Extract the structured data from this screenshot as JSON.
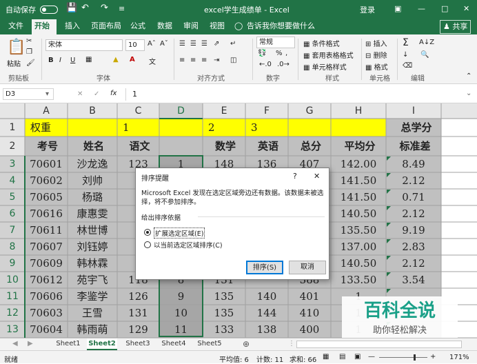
{
  "titlebar": {
    "autosave": "自动保存",
    "title": "excel学生成绩单 - Excel",
    "login": "登录"
  },
  "tabs": [
    "文件",
    "开始",
    "插入",
    "页面布局",
    "公式",
    "数据",
    "审阅",
    "视图"
  ],
  "tell_me": "告诉我你想要做什么",
  "share": "共享",
  "ribbon": {
    "paste": "粘贴",
    "clipboard": "剪贴板",
    "font_name": "宋体",
    "font_size": "10",
    "font_group": "字体",
    "align_group": "对齐方式",
    "num_format": "常规",
    "number_group": "数字",
    "cond_format": "条件格式",
    "table_format": "套用表格格式",
    "cell_style": "单元格样式",
    "styles_group": "样式",
    "insert": "插入",
    "delete": "删除",
    "format": "格式",
    "cells_group": "单元格",
    "editing_group": "编辑"
  },
  "namebox": "D3",
  "fx": "fx",
  "formula": "1",
  "columns": [
    "A",
    "B",
    "C",
    "D",
    "E",
    "F",
    "G",
    "H",
    "I"
  ],
  "rows": [
    "1",
    "2",
    "3",
    "4",
    "5",
    "6",
    "7",
    "8",
    "9",
    "10",
    "11",
    "12",
    "13"
  ],
  "row1": {
    "a": "权重",
    "c": "1",
    "e": "2",
    "f": "3",
    "i": "总学分"
  },
  "row2": {
    "a": "考号",
    "b": "姓名",
    "c": "语文",
    "e": "数学",
    "f": "英语",
    "g": "总分",
    "h": "平均分",
    "i": "标准差"
  },
  "data": [
    [
      "70601",
      "沙龙逸",
      "123",
      "1",
      "148",
      "136",
      "407",
      "142.00",
      "8.49"
    ],
    [
      "70602",
      "刘帅",
      "1",
      "",
      "",
      "",
      "",
      "141.50",
      "2.12"
    ],
    [
      "70605",
      "杨璐",
      "1",
      "",
      "",
      "",
      "",
      "141.50",
      "0.71"
    ],
    [
      "70616",
      "康惠雯",
      "1",
      "",
      "",
      "",
      "",
      "140.50",
      "2.12"
    ],
    [
      "70611",
      "林世博",
      "1",
      "",
      "",
      "",
      "",
      "135.50",
      "9.19"
    ],
    [
      "70607",
      "刘钰婷",
      "1",
      "",
      "",
      "",
      "",
      "137.00",
      "2.83"
    ],
    [
      "70609",
      "韩林霖",
      "1",
      "",
      "",
      "",
      "",
      "140.50",
      "2.12"
    ],
    [
      "70612",
      "苑宇飞",
      "118",
      "8",
      "131",
      "",
      "388",
      "133.50",
      "3.54"
    ],
    [
      "70606",
      "李鉴学",
      "126",
      "9",
      "135",
      "140",
      "401",
      "1",
      ""
    ],
    [
      "70603",
      "王雪",
      "131",
      "10",
      "135",
      "144",
      "410",
      "1",
      ""
    ],
    [
      "70604",
      "韩雨萌",
      "129",
      "11",
      "133",
      "138",
      "400",
      "1",
      ""
    ]
  ],
  "dialog": {
    "title": "排序提醒",
    "help": "?",
    "close": "✕",
    "message": "Microsoft Excel 发现在选定区域旁边还有数据。该数据未被选择，将不参加排序。",
    "section": "给出排序依据",
    "opt1": "扩展选定区域(E)",
    "opt2": "以当前选定区域排序(C)",
    "sort": "排序(S)",
    "cancel": "取消"
  },
  "sheets": [
    "Sheet1",
    "Sheet2",
    "Sheet3",
    "Sheet4",
    "Sheet5"
  ],
  "status": {
    "ready": "就绪",
    "avg": "平均值: 6",
    "count": "计数: 11",
    "sum": "求和: 66",
    "zoom": "171%"
  },
  "watermark": {
    "main": "百科全说",
    "sub": "助你轻松解决"
  },
  "colors": {
    "excel_green": "#217346",
    "highlight_yellow": "#ffff00",
    "header_gray": "#c0c0c0",
    "selection_gray": "#a6a6a6"
  }
}
